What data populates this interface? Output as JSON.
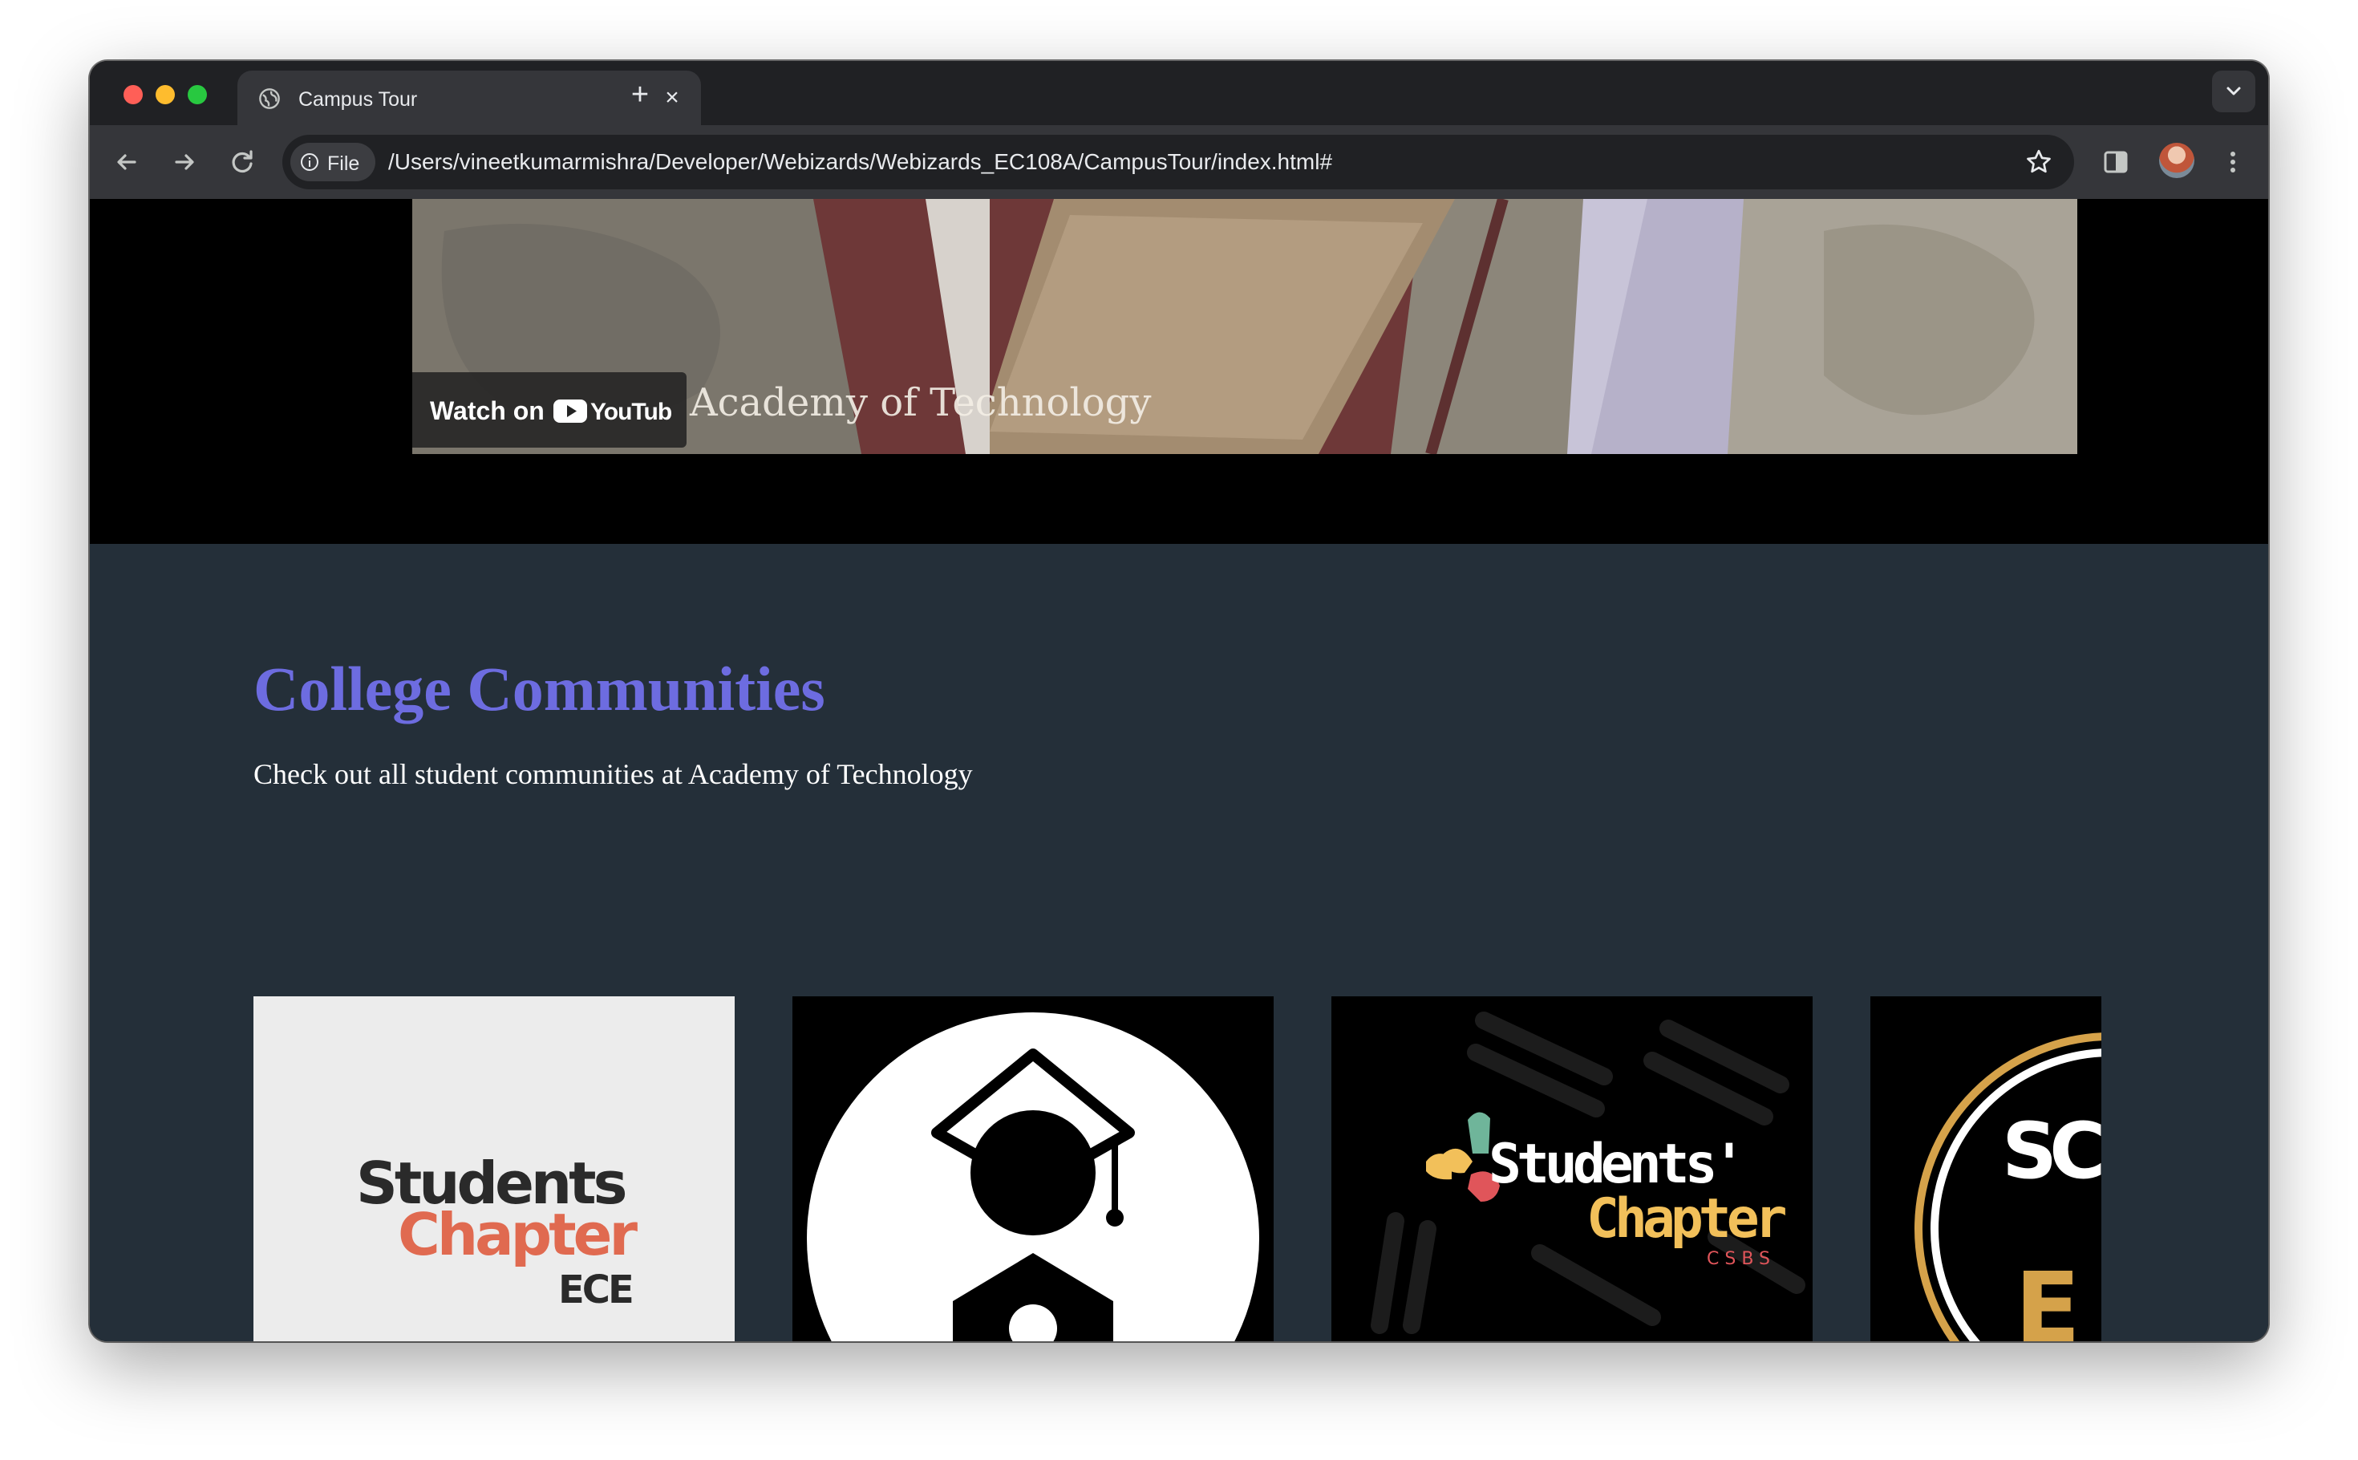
{
  "browser": {
    "tab": {
      "title": "Campus Tour",
      "close_icon": "close-icon",
      "favicon": "globe-icon"
    },
    "new_tab_icon": "plus-icon",
    "address_bar": {
      "scheme_label": "File",
      "url": "/Users/vineetkumarmishra/Developer/Webizards/Webizards_EC108A/CampusTour/index.html#"
    }
  },
  "video": {
    "watch_label": "Watch on",
    "brand": "YouTube",
    "caption": "Academy of Technology"
  },
  "section": {
    "heading": "College Communities",
    "subtitle": "Check out all student communities at Academy of Technology",
    "heading_color": "#6d6ce0",
    "background_color": "#242f39"
  },
  "cards": [
    {
      "name": "students-chapter-ece",
      "line1": "Students",
      "line2": "Chapter",
      "line3": "ECE"
    },
    {
      "name": "graduate-community",
      "icon": "graduation-cap-icon"
    },
    {
      "name": "students-chapter-csbs",
      "line1": "Students'",
      "line2": "Chapter",
      "line3": "CSBS"
    },
    {
      "name": "sc-partial",
      "line1": "SC",
      "line2": "E"
    }
  ]
}
